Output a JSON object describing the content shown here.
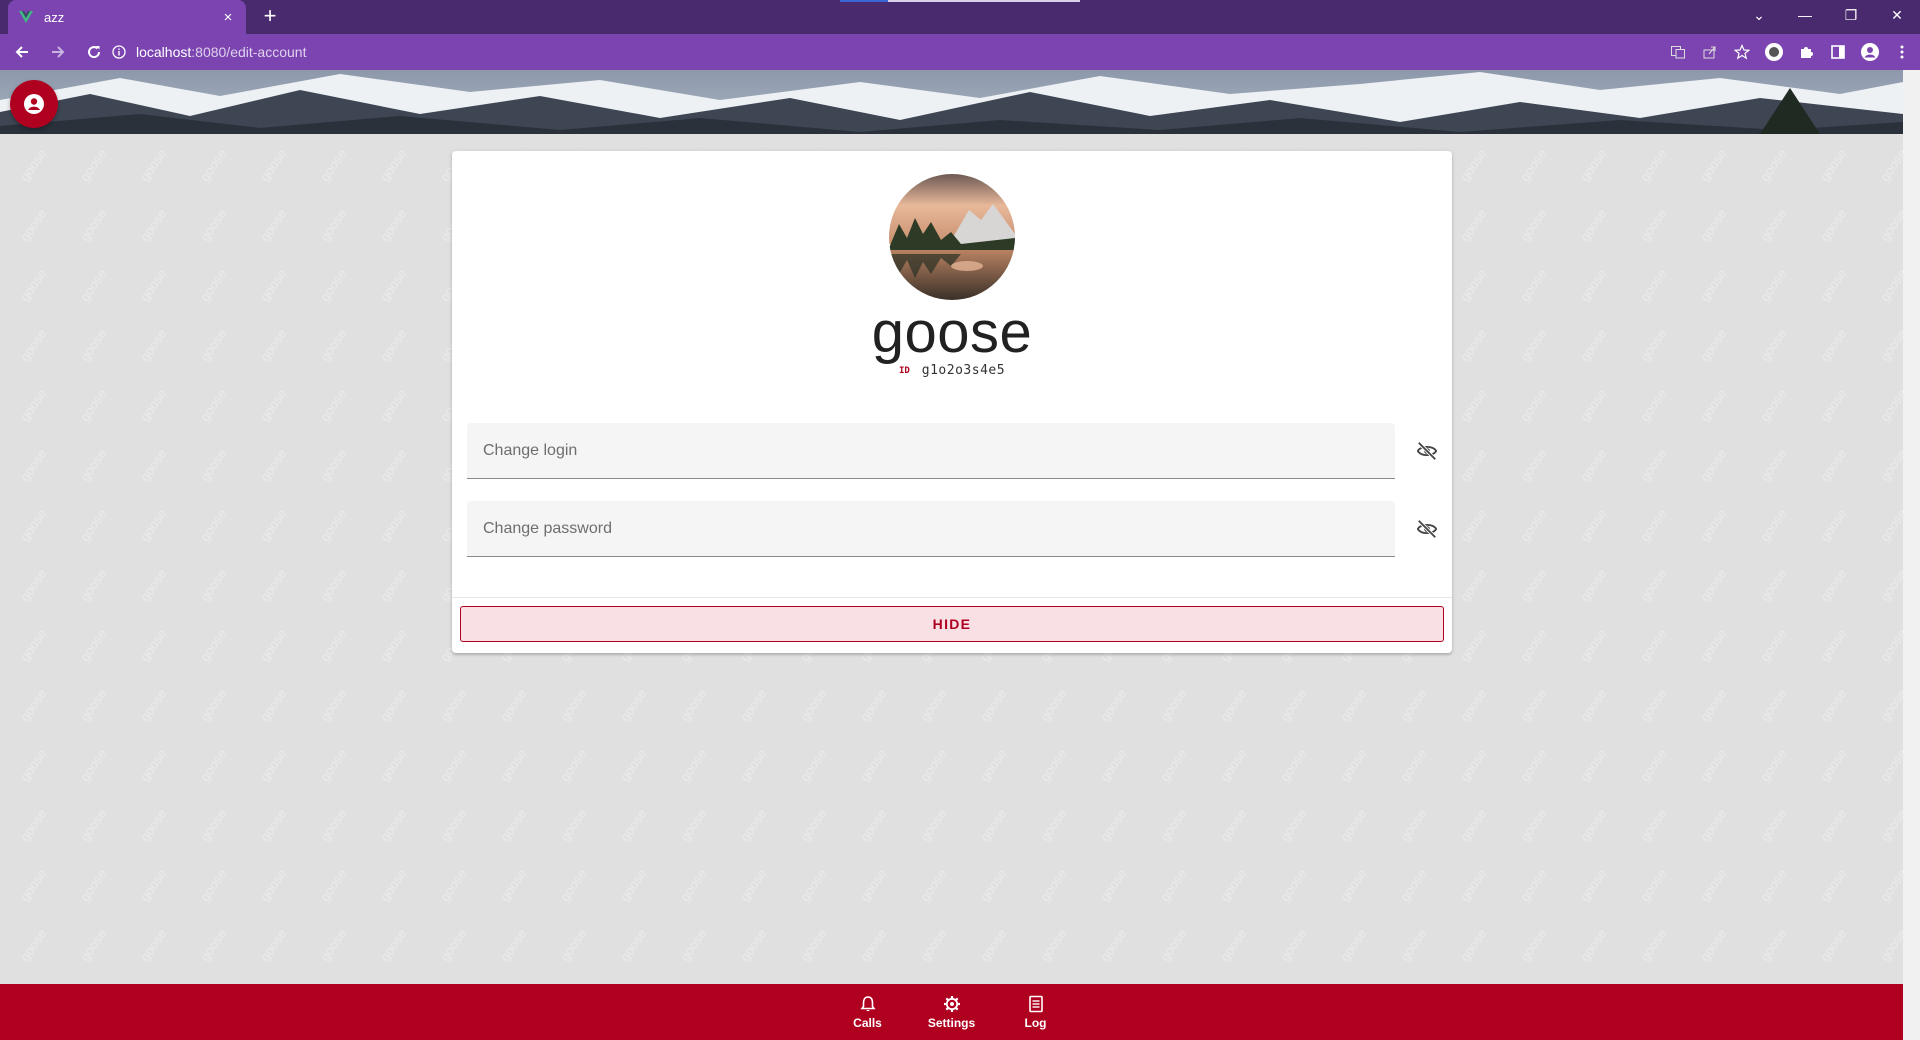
{
  "browser": {
    "tab_title": "azz",
    "tab_close": "×",
    "new_tab": "+",
    "url_host": "localhost",
    "url_path": ":8080/edit-account",
    "window_controls": [
      "⌄",
      "—",
      "❐",
      "✕"
    ]
  },
  "app": {
    "watermark_text": "goose",
    "accent_color": "#b00020",
    "user_icon": "account-circle-icon"
  },
  "profile": {
    "username": "goose",
    "id_label": "ID",
    "id_value": "g1o2o3s4e5"
  },
  "form": {
    "login_placeholder": "Change login",
    "password_placeholder": "Change password",
    "login_visibility_icon": "eye-off-icon",
    "password_visibility_icon": "eye-off-icon",
    "hide_button": "HIDE"
  },
  "bottom_nav": {
    "items": [
      {
        "label": "Calls",
        "icon": "bell-icon"
      },
      {
        "label": "Settings",
        "icon": "gear-icon"
      },
      {
        "label": "Log",
        "icon": "document-icon"
      }
    ]
  }
}
